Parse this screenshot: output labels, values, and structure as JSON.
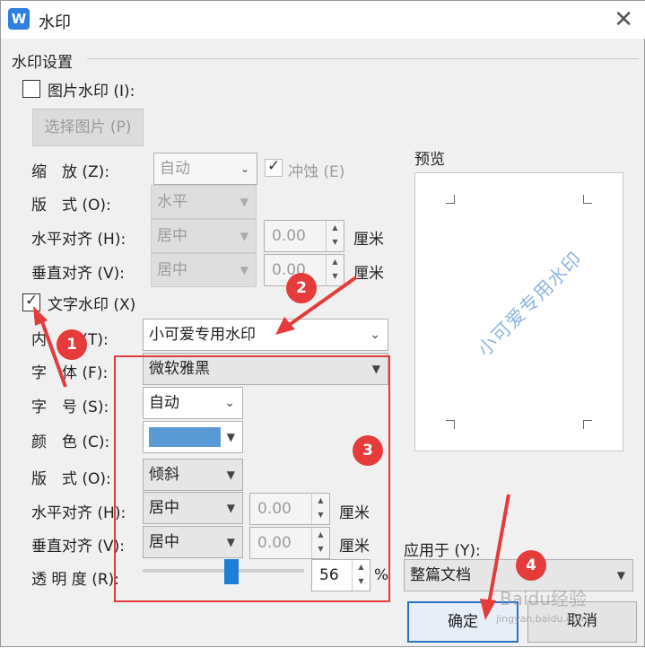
{
  "title_bar": {
    "app_icon": "W",
    "title": "水印"
  },
  "group_title": "水印设置",
  "picture": {
    "checkbox_label": "图片水印 (I):",
    "select_button": "选择图片 (P)",
    "scale_label": "缩　放 (Z):",
    "scale_value": "自动",
    "erode_label": "冲蚀 (E)",
    "layout_label": "版　式 (O):",
    "layout_value": "水平",
    "halign_label": "水平对齐 (H):",
    "halign_value": "居中",
    "halign_offset": "0.00",
    "valign_label": "垂直对齐 (V):",
    "valign_value": "居中",
    "valign_offset": "0.00",
    "unit": "厘米"
  },
  "text": {
    "checkbox_label": "文字水印 (X)",
    "content_label": "内　容 (T):",
    "content_value": "小可爱专用水印",
    "font_label": "字　体 (F):",
    "font_value": "微软雅黑",
    "size_label": "字　号 (S):",
    "size_value": "自动",
    "color_label": "颜　色 (C):",
    "color_swatch": "#5b9bd5",
    "layout_label": "版　式 (O):",
    "layout_value": "倾斜",
    "halign_label": "水平对齐 (H):",
    "halign_value": "居中",
    "halign_offset": "0.00",
    "valign_label": "垂直对齐 (V):",
    "valign_value": "居中",
    "valign_offset": "0.00",
    "unit": "厘米",
    "opacity_label": "透 明 度 (R):",
    "opacity_value": "56",
    "opacity_fraction": 0.56,
    "percent": "%"
  },
  "preview": {
    "title": "预览",
    "watermark_text": "小可爱专用水印"
  },
  "apply": {
    "label": "应用于 (Y):",
    "value": "整篇文档"
  },
  "buttons": {
    "ok": "确定",
    "cancel": "取消"
  },
  "annotations": {
    "b1": "1",
    "b2": "2",
    "b3": "3",
    "b4": "4",
    "accent": "#e53b3b"
  },
  "overlay_watermark": "Baidu经验",
  "overlay_url": "jingyan.baidu.com"
}
